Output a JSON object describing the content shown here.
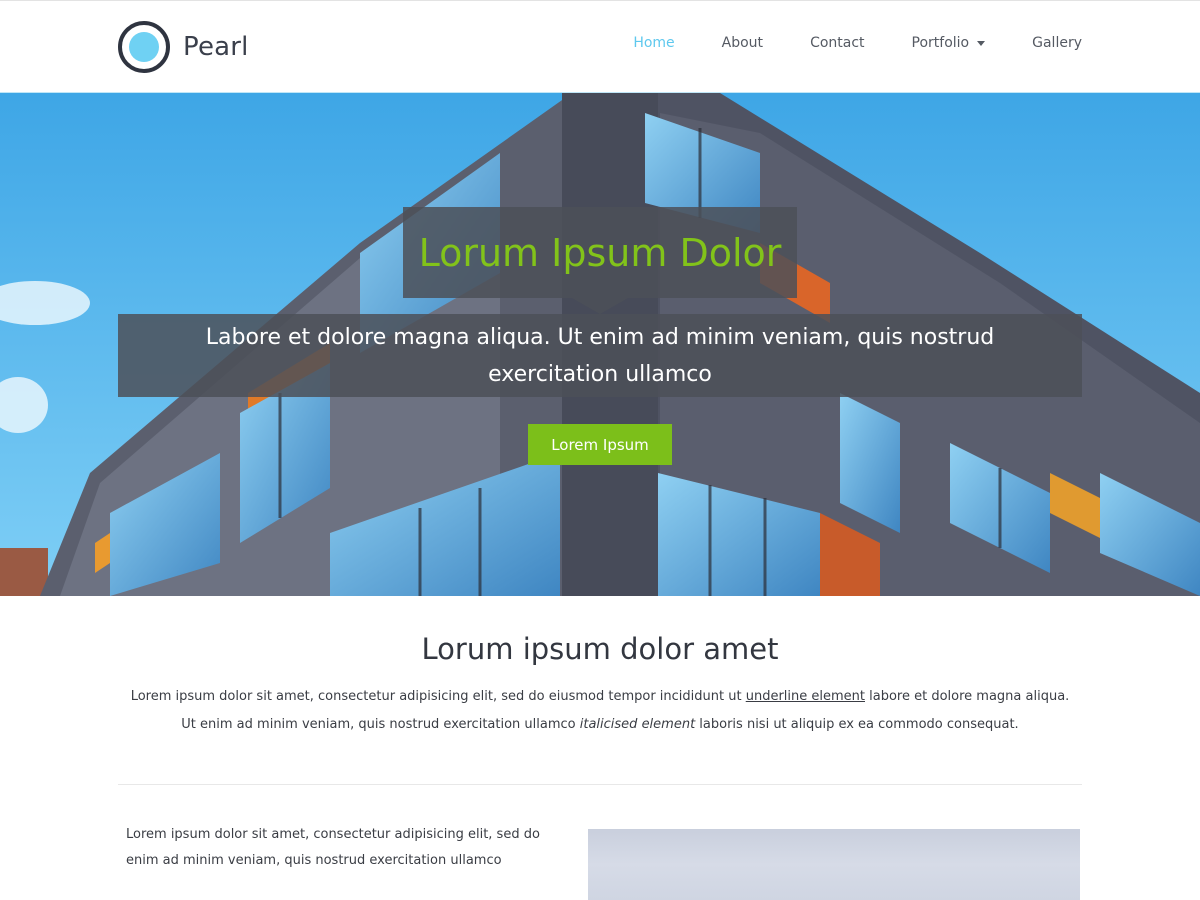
{
  "brand": {
    "name": "Pearl"
  },
  "nav": {
    "items": [
      {
        "label": "Home",
        "active": true
      },
      {
        "label": "About",
        "active": false
      },
      {
        "label": "Contact",
        "active": false
      },
      {
        "label": "Portfolio",
        "active": false,
        "dropdown": true
      },
      {
        "label": "Gallery",
        "active": false
      }
    ]
  },
  "hero": {
    "title": "Lorum Ipsum Dolor",
    "subtitle": "Labore et dolore magna aliqua. Ut enim ad minim veniam, quis nostrud exercitation ullamco",
    "button_label": "Lorem Ipsum"
  },
  "intro": {
    "title": "Lorum ipsum dolor amet",
    "text_part1": "Lorem ipsum dolor sit amet, consectetur adipisicing elit, sed do eiusmod tempor incididunt ut ",
    "underline": "underline element",
    "text_part2": " labore et dolore magna aliqua. Ut enim ad minim veniam, quis nostrud exercitation ullamco ",
    "italic": "italicised element",
    "text_part3": " laboris nisi ut aliquip ex ea commodo consequat."
  },
  "column": {
    "text": "Lorem ipsum dolor sit amet, consectetur adipisicing elit, sed do enim ad minim veniam, quis nostrud exercitation ullamco"
  },
  "colors": {
    "accent_blue": "#5ec8ee",
    "accent_green": "#7cbf1a",
    "overlay": "#4c5058"
  }
}
